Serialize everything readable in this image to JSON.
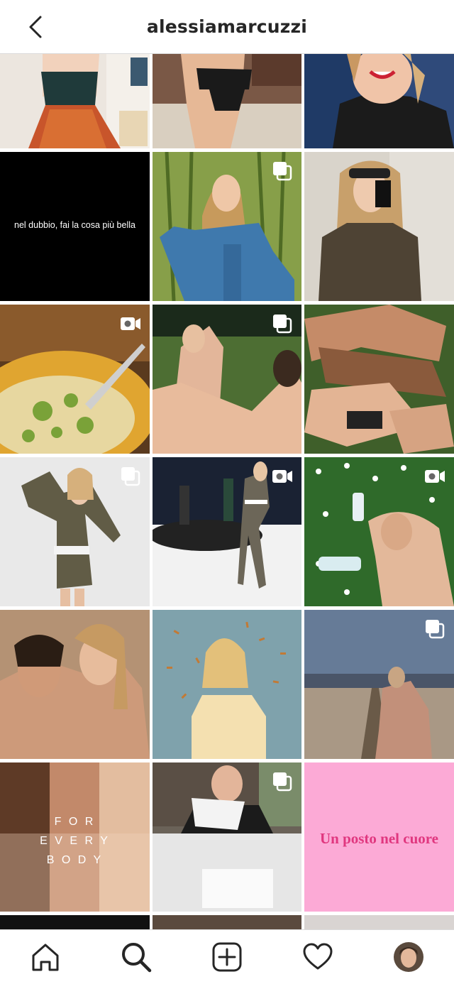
{
  "header": {
    "title": "alessiamarcuzzi"
  },
  "tiles": [
    {
      "row": 1,
      "col": 1,
      "type": "photo"
    },
    {
      "row": 1,
      "col": 2,
      "type": "photo"
    },
    {
      "row": 1,
      "col": 3,
      "type": "photo"
    },
    {
      "row": 2,
      "col": 1,
      "type": "text-post",
      "caption": "nel dubbio, fai la cosa più bella"
    },
    {
      "row": 2,
      "col": 2,
      "type": "carousel"
    },
    {
      "row": 2,
      "col": 3,
      "type": "photo"
    },
    {
      "row": 3,
      "col": 1,
      "type": "video"
    },
    {
      "row": 3,
      "col": 2,
      "type": "carousel"
    },
    {
      "row": 3,
      "col": 3,
      "type": "photo"
    },
    {
      "row": 4,
      "col": 1,
      "type": "carousel"
    },
    {
      "row": 4,
      "col": 2,
      "type": "video"
    },
    {
      "row": 4,
      "col": 3,
      "type": "video"
    },
    {
      "row": 5,
      "col": 1,
      "type": "photo"
    },
    {
      "row": 5,
      "col": 2,
      "type": "photo"
    },
    {
      "row": 5,
      "col": 3,
      "type": "carousel"
    },
    {
      "row": 6,
      "col": 1,
      "type": "text-post",
      "caption_lines": [
        "F O R",
        "E V E R Y",
        "B O D Y"
      ]
    },
    {
      "row": 6,
      "col": 2,
      "type": "carousel"
    },
    {
      "row": 6,
      "col": 3,
      "type": "text-post",
      "caption": "Un posto nel cuore",
      "accent": "#e0377f"
    }
  ],
  "bottom_nav": {
    "items": [
      "home-icon",
      "search-icon",
      "add-post-icon",
      "activity-heart-icon",
      "profile-avatar"
    ]
  },
  "colors": {
    "header_text": "#262626",
    "divider": "#dbdbdb",
    "pink_tile": "#fcaad6"
  }
}
